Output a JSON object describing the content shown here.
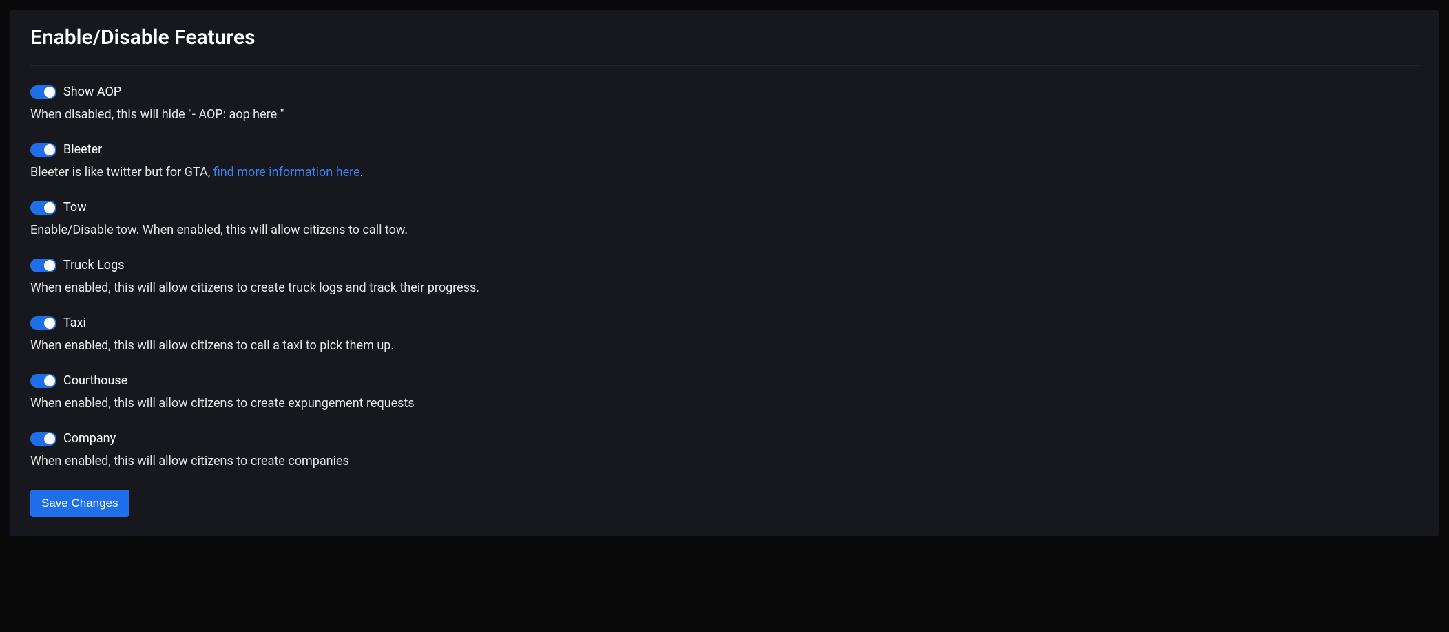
{
  "panel": {
    "title": "Enable/Disable Features",
    "save_label": "Save Changes"
  },
  "features": {
    "show_aop": {
      "label": "Show AOP",
      "desc": "When disabled, this will hide \"- AOP: aop here \"",
      "enabled": true
    },
    "bleeter": {
      "label": "Bleeter",
      "desc_prefix": "Bleeter is like twitter but for GTA, ",
      "link_text": "find more information here",
      "desc_suffix": ".",
      "enabled": true
    },
    "tow": {
      "label": "Tow",
      "desc": "Enable/Disable tow. When enabled, this will allow citizens to call tow.",
      "enabled": true
    },
    "truck_logs": {
      "label": "Truck Logs",
      "desc": "When enabled, this will allow citizens to create truck logs and track their progress.",
      "enabled": true
    },
    "taxi": {
      "label": "Taxi",
      "desc": "When enabled, this will allow citizens to call a taxi to pick them up.",
      "enabled": true
    },
    "courthouse": {
      "label": "Courthouse",
      "desc": "When enabled, this will allow citizens to create expungement requests",
      "enabled": true
    },
    "company": {
      "label": "Company",
      "desc": "When enabled, this will allow citizens to create companies",
      "enabled": true
    }
  }
}
